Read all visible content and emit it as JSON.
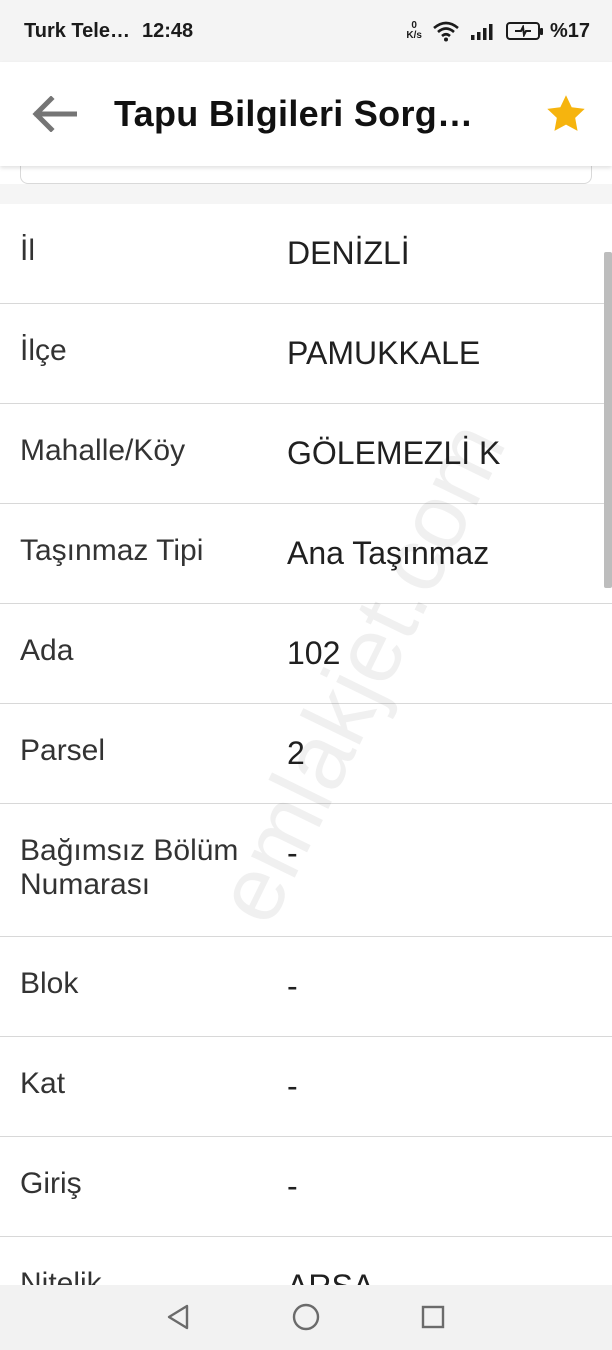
{
  "status_bar": {
    "carrier": "Turk Tele…",
    "time": "12:48",
    "net_speed_value": "0",
    "net_speed_unit": "K/s",
    "battery": "%17"
  },
  "app_bar": {
    "title": "Tapu Bilgileri Sorg…",
    "back_icon": "arrow-left-icon",
    "favorite_icon": "star-icon",
    "star_color": "#f6b40e"
  },
  "rows": [
    {
      "label": "İl",
      "value": "DENİZLİ"
    },
    {
      "label": "İlçe",
      "value": "PAMUKKALE"
    },
    {
      "label": "Mahalle/Köy",
      "value": "GÖLEMEZLİ K"
    },
    {
      "label": "Taşınmaz Tipi",
      "value": "Ana Taşınmaz"
    },
    {
      "label": "Ada",
      "value": "102"
    },
    {
      "label": "Parsel",
      "value": "2"
    },
    {
      "label": "Bağımsız Bölüm Numarası",
      "value": "-"
    },
    {
      "label": "Blok",
      "value": "-"
    },
    {
      "label": "Kat",
      "value": "-"
    },
    {
      "label": "Giriş",
      "value": "-"
    },
    {
      "label": "Nitelik",
      "value": "ARSA"
    }
  ],
  "watermark": "emlakjet.com",
  "nav_bar": {
    "back": "triangle-back-icon",
    "home": "circle-home-icon",
    "recents": "square-recents-icon"
  }
}
